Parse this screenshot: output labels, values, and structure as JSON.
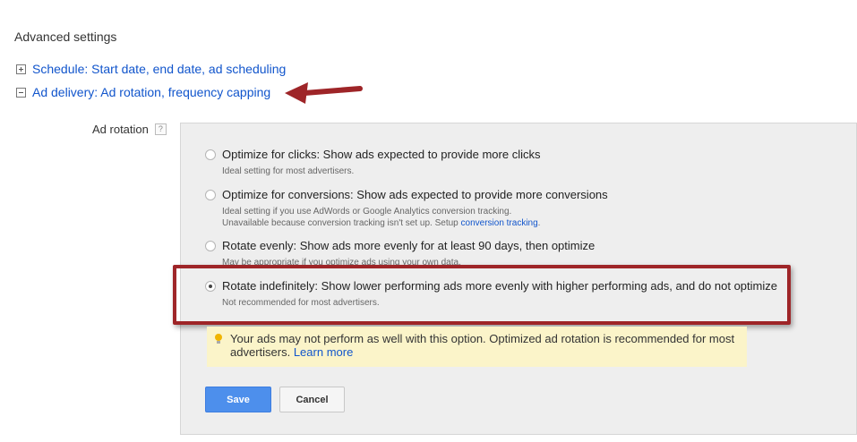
{
  "section_title": "Advanced settings",
  "expanders": {
    "schedule": "Schedule: Start date, end date, ad scheduling",
    "delivery": "Ad delivery: Ad rotation, frequency capping"
  },
  "ad_rotation": {
    "label": "Ad rotation",
    "help": "?",
    "options": [
      {
        "title": "Optimize for clicks: Show ads expected to provide more clicks",
        "sub1": "Ideal setting for most advertisers.",
        "sub2": "",
        "selected": false
      },
      {
        "title": "Optimize for conversions: Show ads expected to provide more conversions",
        "sub1": "Ideal setting if you use AdWords or Google Analytics conversion tracking.",
        "sub2": "Unavailable because conversion tracking isn't set up. Setup",
        "sub2_link": "conversion tracking",
        "sub2_end": ".",
        "selected": false
      },
      {
        "title": "Rotate evenly: Show ads more evenly for at least 90 days, then optimize",
        "sub1": "May be appropriate if you optimize ads using your own data.",
        "sub2": "",
        "selected": false
      },
      {
        "title": "Rotate indefinitely: Show lower performing ads more evenly with higher performing ads, and do not optimize",
        "sub1": "Not recommended for most advertisers.",
        "sub2": "",
        "selected": true
      }
    ],
    "warning": {
      "text": "Your ads may not perform as well with this option. Optimized ad rotation is recommended for most advertisers.",
      "link": "Learn more"
    }
  },
  "buttons": {
    "save": "Save",
    "cancel": "Cancel"
  },
  "colors": {
    "link": "#1155cc",
    "highlight": "#9e2528",
    "save_button": "#4d8fec",
    "warning_bg": "#fbf4c9"
  }
}
